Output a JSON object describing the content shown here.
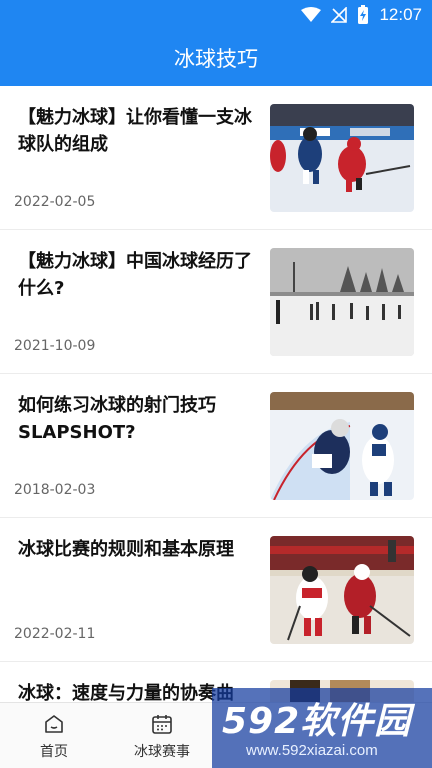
{
  "status_bar": {
    "time": "12:07"
  },
  "app_bar": {
    "title": "冰球技巧"
  },
  "articles": [
    {
      "title": "【魅力冰球】让你看懂一支冰球队的组成",
      "date": "2022-02-05"
    },
    {
      "title": "【魅力冰球】中国冰球经历了什么?",
      "date": "2021-10-09"
    },
    {
      "title": "如何练习冰球的射门技巧SLAPSHOT?",
      "date": "2018-02-03"
    },
    {
      "title": "冰球比赛的规则和基本原理",
      "date": "2022-02-11"
    },
    {
      "title": "冰球：速度与力量的协奏曲",
      "date": ""
    }
  ],
  "tabs": [
    {
      "label": "首页",
      "icon": "home-icon"
    },
    {
      "label": "冰球赛事",
      "icon": "calendar-icon"
    },
    {
      "label": "",
      "icon": ""
    },
    {
      "label": "",
      "icon": ""
    }
  ],
  "watermark": {
    "main": "592软件园",
    "url": "www.592xiazai.com"
  },
  "colors": {
    "primary": "#1f86f2",
    "ice": "#e9eef5",
    "red_jersey": "#c8232c"
  }
}
